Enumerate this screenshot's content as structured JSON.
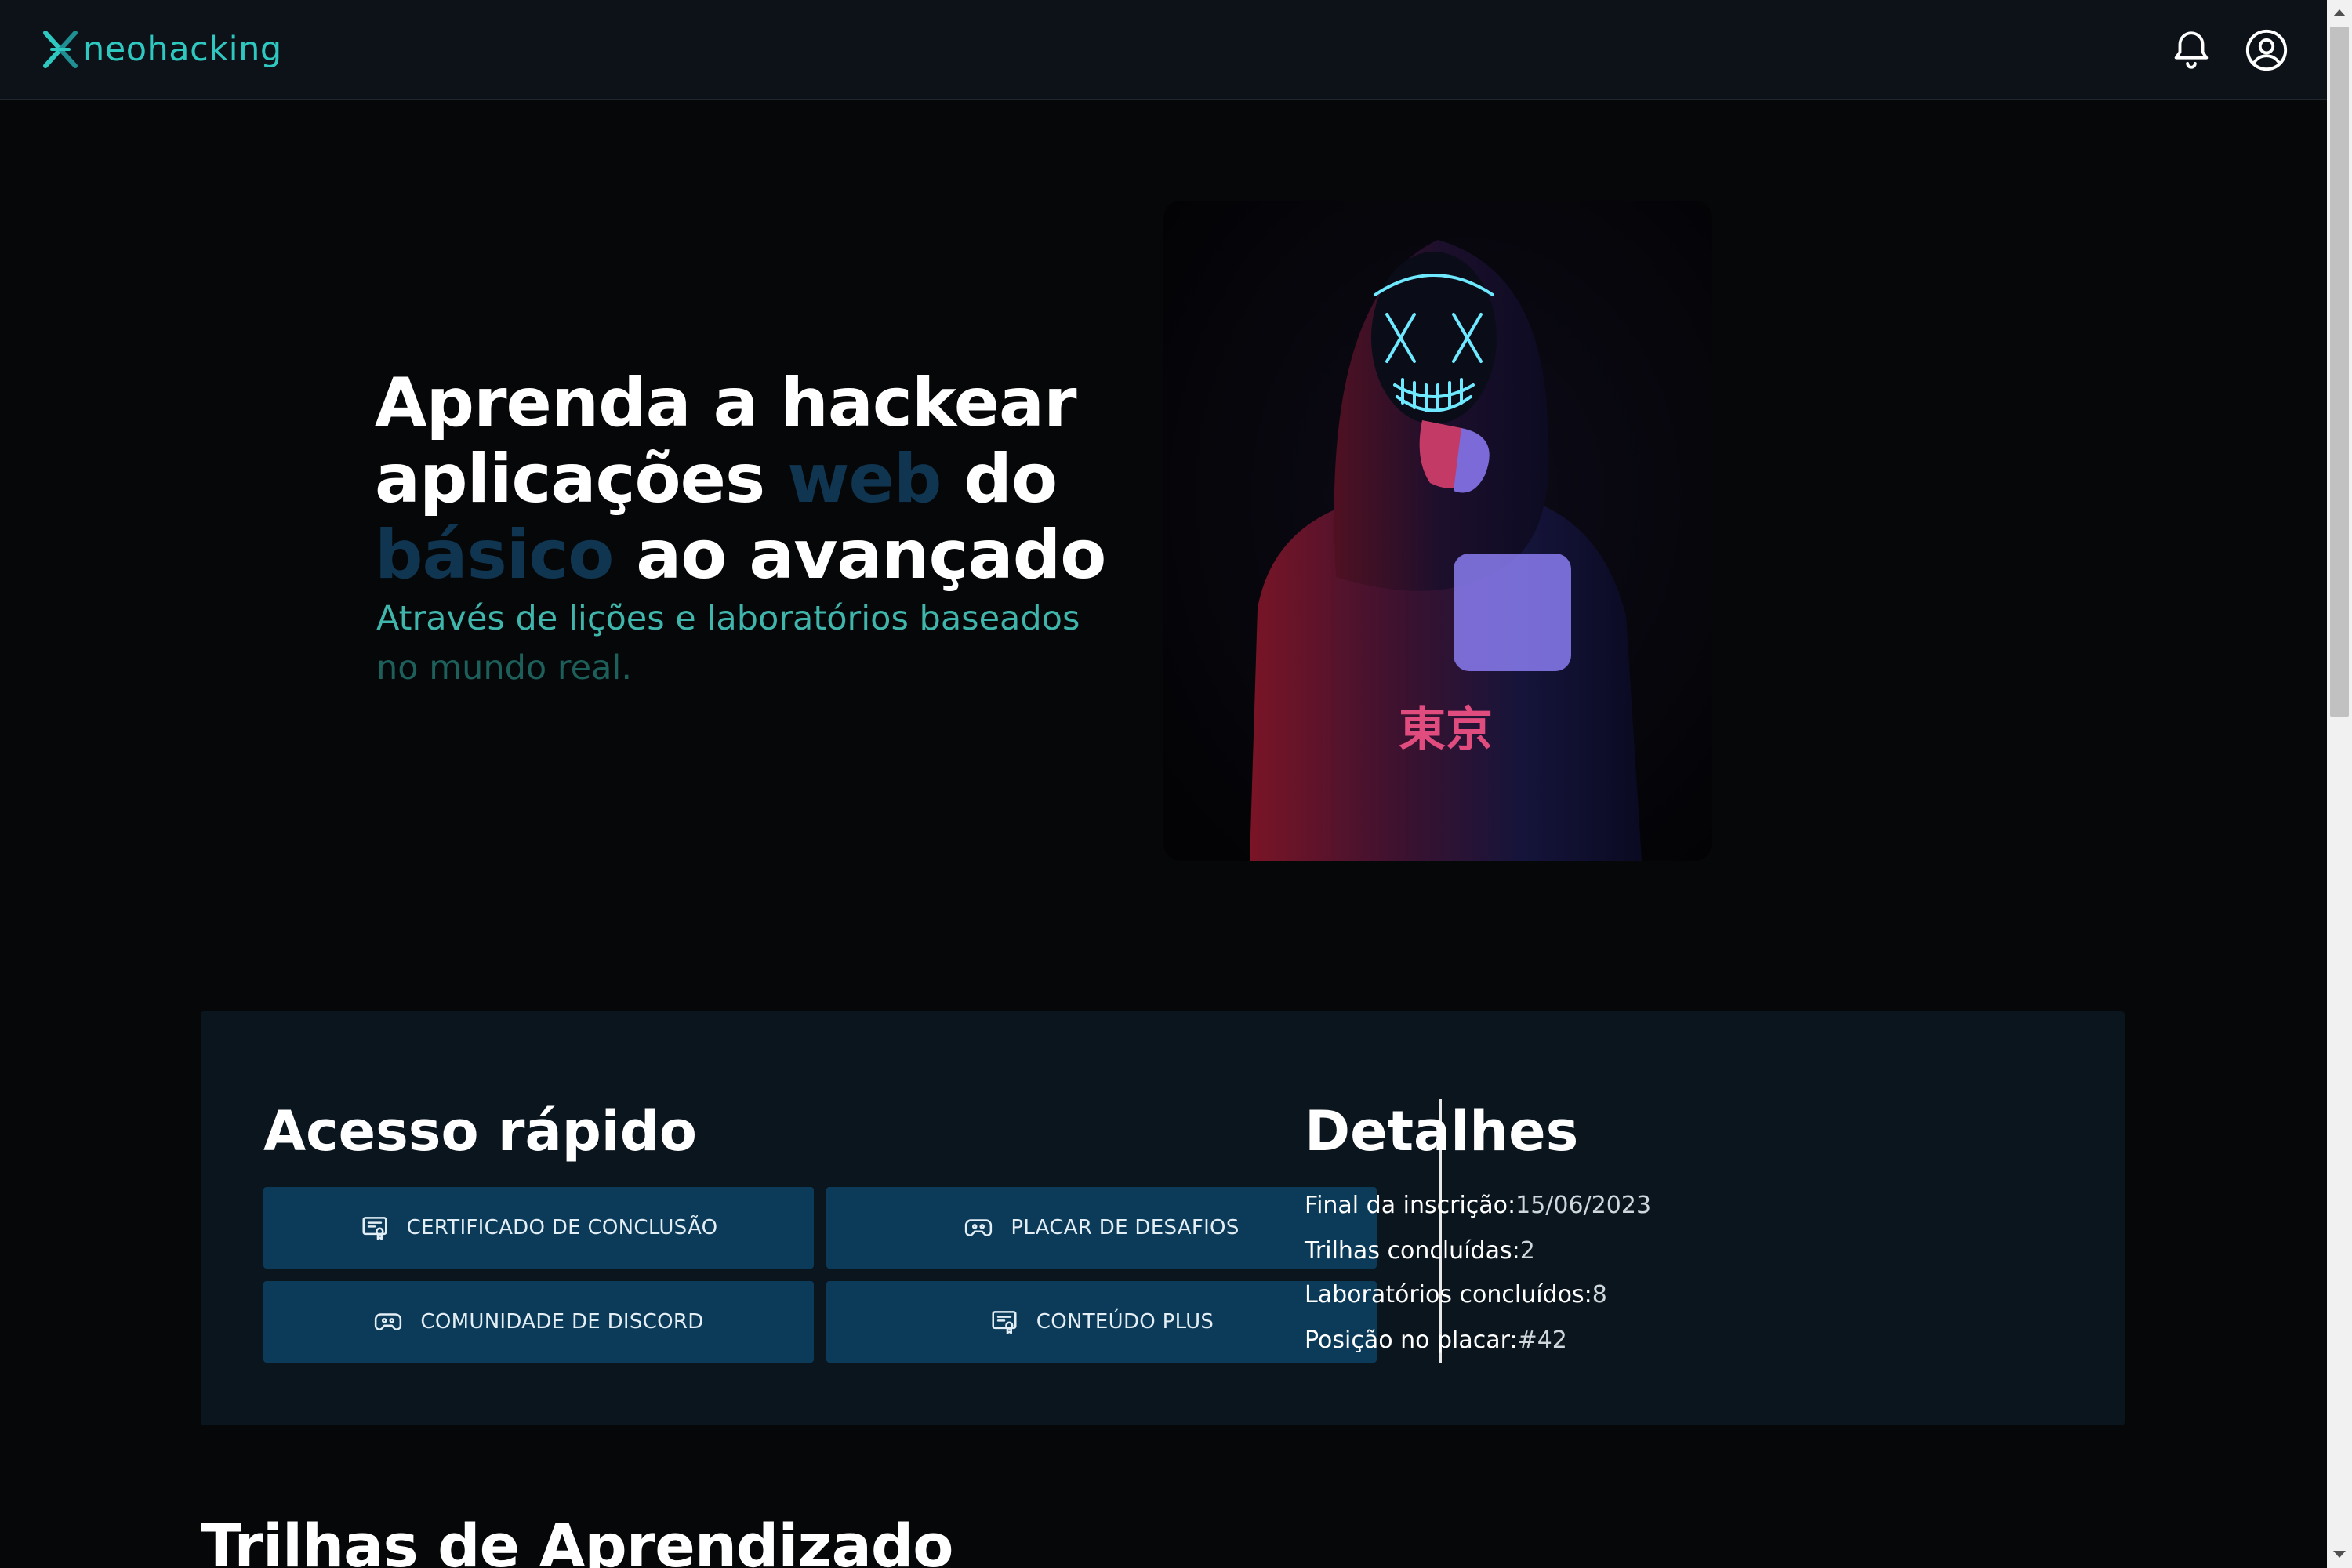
{
  "navbar": {
    "logo_text": "neohacking",
    "icons": [
      "bell-icon",
      "user-circle-icon"
    ]
  },
  "hero": {
    "title_part1": "Aprenda a hackear",
    "title_part2": "aplicações ",
    "title_highlight1": "web",
    "title_part3": " do",
    "title_highlight2": "básico",
    "title_part4": " ao avançado",
    "subtitle_line1": "Através de lições e laboratórios baseados",
    "subtitle_line2": "no mundo real."
  },
  "quick_access": {
    "title": "Acesso rápido",
    "buttons": [
      {
        "label": "CERTIFICADO DE CONCLUSÃO",
        "icon": "certificate-icon"
      },
      {
        "label": "PLACAR DE DESAFIOS",
        "icon": "gamepad-icon"
      },
      {
        "label": "COMUNIDADE DE DISCORD",
        "icon": "discord-icon"
      },
      {
        "label": "CONTEÚDO PLUS",
        "icon": "certificate-icon"
      }
    ]
  },
  "details": {
    "title": "Detalhes",
    "rows": [
      {
        "key": "Final da inscrição:",
        "value": "15/06/2023"
      },
      {
        "key": "Trilhas concluídas:",
        "value": "2"
      },
      {
        "key": "Laboratórios concluídos:",
        "value": "8"
      },
      {
        "key": "Posição no placar:",
        "value": "#42"
      }
    ]
  },
  "section": {
    "title": "Trilhas de Aprendizado"
  },
  "colors": {
    "accent": "#2fc8c1",
    "button_bg": "#0c3b5a",
    "panel_bg": "#0b151e",
    "navbar_bg": "#0d1218",
    "page_bg": "#060708"
  }
}
